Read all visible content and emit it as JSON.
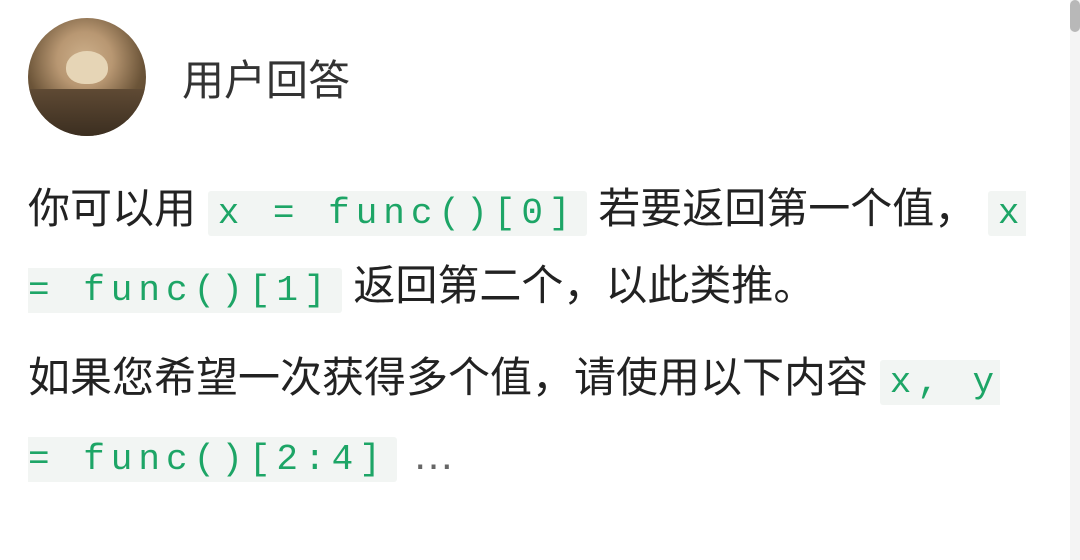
{
  "header": {
    "username": "用户回答"
  },
  "content": {
    "p1_before_code1": "你可以用",
    "code1": "x = func()[0]",
    "p1_mid": "若要返回第一个值，",
    "code2": "x = func()[1]",
    "p1_after_code2": "返回第二个，以此类推。",
    "p2_text": "如果您希望一次获得多个值，请使用以下内容",
    "code3": "x, y = func()[2:4]",
    "ellipsis": "…"
  }
}
